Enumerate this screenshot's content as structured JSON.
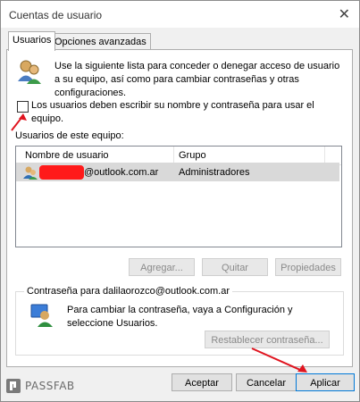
{
  "window": {
    "title": "Cuentas de usuario",
    "close_glyph": "✕"
  },
  "tabs": [
    {
      "label": "Usuarios"
    },
    {
      "label": "Opciones avanzadas"
    }
  ],
  "intro": {
    "text": "Use la siguiente lista para conceder o denegar acceso de usuario a su equipo, así como para cambiar contraseñas y otras configuraciones.",
    "icon": "users-icon"
  },
  "login_checkbox": {
    "label": "Los usuarios deben escribir su nombre y contraseña para usar el equipo.",
    "checked": false
  },
  "users_section": {
    "label": "Usuarios de este equipo:",
    "columns": [
      "Nombre de usuario",
      "Grupo"
    ],
    "rows": [
      {
        "name": "@outlook.com.ar",
        "group": "Administradores",
        "icon": "user-icon"
      }
    ]
  },
  "user_buttons": {
    "add": "Agregar...",
    "remove": "Quitar",
    "properties": "Propiedades"
  },
  "password_group": {
    "title": "Contraseña para dalilaorozco@outlook.com.ar",
    "text": "Para cambiar la contraseña, vaya a Configuración y seleccione Usuarios.",
    "reset_button": "Restablecer contraseña...",
    "icon": "user-key-icon"
  },
  "footer": {
    "accept": "Aceptar",
    "cancel": "Cancelar",
    "apply": "Aplicar"
  },
  "watermark": {
    "text": "PASSFAB",
    "icon": "passfab-logo-icon"
  },
  "colors": {
    "annotation_red": "#e0141f",
    "redaction": "#ff1a1a",
    "selected_row": "#d9d9d9"
  }
}
